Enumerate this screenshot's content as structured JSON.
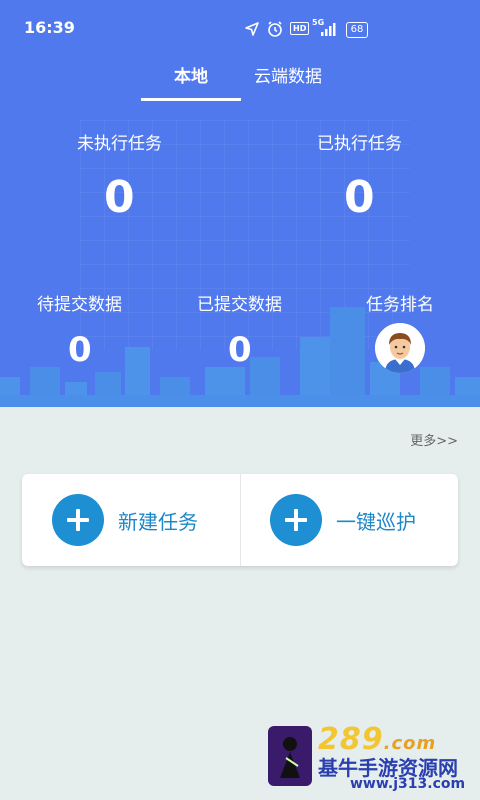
{
  "status_bar": {
    "time": "16:39",
    "network": "5G",
    "hd": "HD",
    "battery": "68"
  },
  "tabs": [
    {
      "label": "本地"
    },
    {
      "label": "云端数据"
    }
  ],
  "stats": {
    "unexecuted_label": "未执行任务",
    "unexecuted_value": "0",
    "executed_label": "已执行任务",
    "executed_value": "0",
    "pending_label": "待提交数据",
    "pending_value": "0",
    "submitted_label": "已提交数据",
    "submitted_value": "0",
    "ranking_label": "任务排名"
  },
  "more_label": "更多>>",
  "actions": {
    "new_task": "新建任务",
    "patrol": "一键巡护"
  },
  "watermark": {
    "site_title": "基牛手游资源网",
    "site_url": "www.j313.com"
  },
  "colors": {
    "header_blue": "#5079ee",
    "action_blue": "#1d8fd2",
    "background": "#e6eded"
  },
  "icons": [
    "location-icon",
    "alarm-icon",
    "signal-icon",
    "battery-icon",
    "plus-icon",
    "avatar-icon"
  ]
}
